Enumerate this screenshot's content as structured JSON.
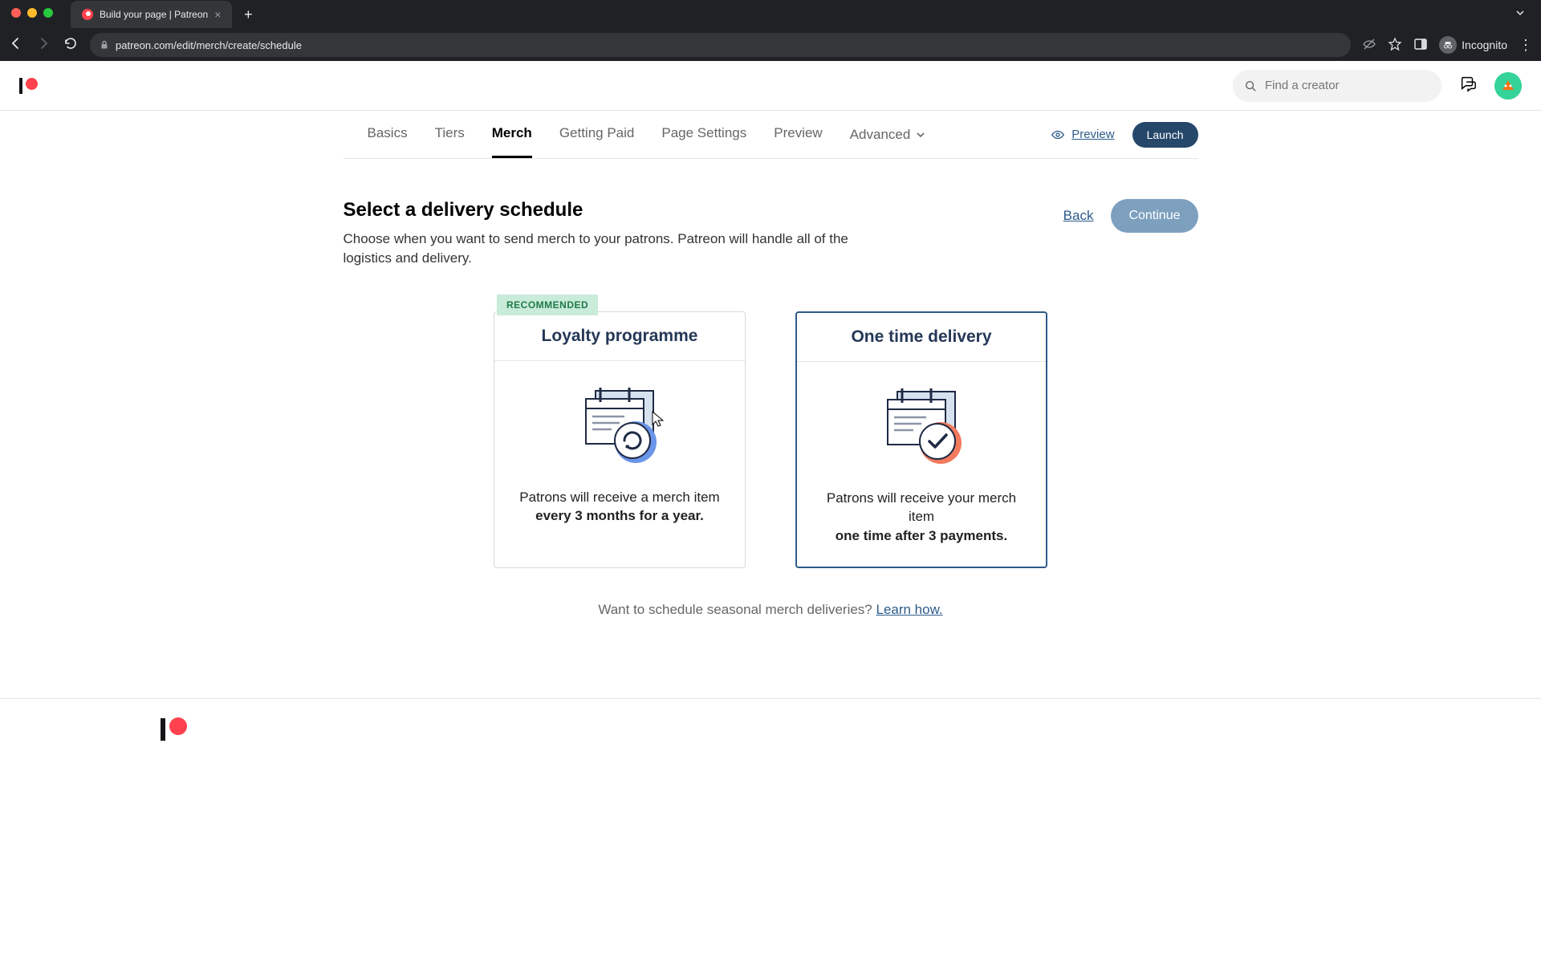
{
  "browser": {
    "tab_title": "Build your page | Patreon",
    "url": "patreon.com/edit/merch/create/schedule",
    "incognito_label": "Incognito"
  },
  "header": {
    "search_placeholder": "Find a creator"
  },
  "nav": {
    "tabs": [
      "Basics",
      "Tiers",
      "Merch",
      "Getting Paid",
      "Page Settings",
      "Preview",
      "Advanced"
    ],
    "active_index": 2,
    "preview_link": "Preview",
    "launch_label": "Launch"
  },
  "main": {
    "title": "Select a delivery schedule",
    "subtitle": "Choose when you want to send merch to your patrons. Patreon will handle all of the logistics and delivery.",
    "back_label": "Back",
    "continue_label": "Continue"
  },
  "cards": {
    "recommended_badge": "RECOMMENDED",
    "loyalty": {
      "title": "Loyalty programme",
      "text_a": "Patrons will receive a merch item",
      "text_b": "every 3 months for a year."
    },
    "onetime": {
      "title": "One time delivery",
      "text_a": "Patrons will receive your merch item",
      "text_b": "one time after 3 payments."
    },
    "selected": "onetime"
  },
  "hint": {
    "prefix": "Want to schedule seasonal merch deliveries? ",
    "link": "Learn how."
  }
}
